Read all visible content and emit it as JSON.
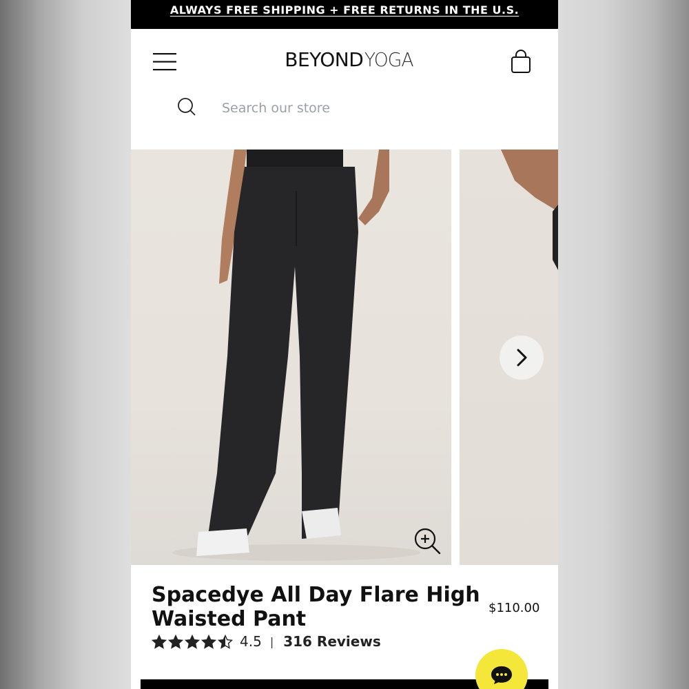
{
  "promo": {
    "text": "ALWAYS FREE SHIPPING + FREE RETURNS IN THE U.S."
  },
  "header": {
    "logo_bold": "BEYOND",
    "logo_light": "YOGA",
    "menu_icon": "hamburger-menu-icon",
    "cart_icon": "shopping-bag-icon"
  },
  "search": {
    "placeholder": "Search our store",
    "value": "",
    "icon": "search-icon"
  },
  "gallery": {
    "next_icon": "chevron-right-icon",
    "zoom_icon": "zoom-in-icon"
  },
  "product": {
    "title": "Spacedye All Day Flare High Waisted Pant",
    "price": "$110.00",
    "rating": "4.5",
    "rating_stars": 4.5,
    "reviews": "316 Reviews",
    "divider": "|"
  },
  "chat": {
    "icon": "chat-bubble-icon"
  },
  "colors": {
    "promo_bg": "#000000",
    "chat_bg": "#f5e63a",
    "text": "#111111",
    "placeholder": "#9aa0a6"
  }
}
